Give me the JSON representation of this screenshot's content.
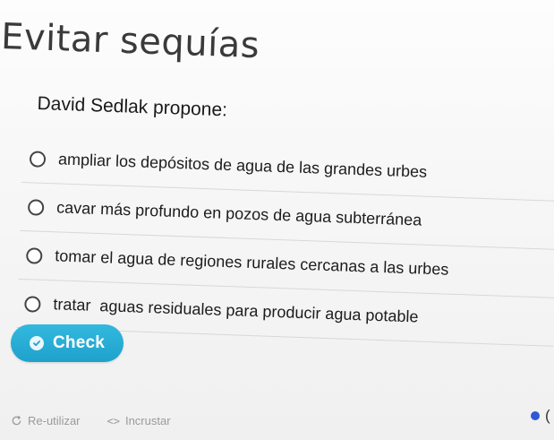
{
  "quiz": {
    "title": "Evitar sequías",
    "question": "David Sedlak propone:",
    "options": [
      {
        "label": "ampliar los depósitos de agua de las grandes urbes"
      },
      {
        "label": "cavar más profundo en pozos de agua subterránea"
      },
      {
        "label": "tomar el agua de regiones rurales cercanas a las urbes"
      },
      {
        "label": "tratar  aguas residuales para producir agua potable"
      }
    ],
    "check_label": "Check"
  },
  "footer": {
    "reuse_label": "Re-utilizar",
    "embed_label": "Incrustar",
    "embed_icon_text": "<>",
    "bracket_text": "("
  },
  "colors": {
    "button": "#1ea2cc",
    "dot": "#2f59d9"
  },
  "icons": {
    "check": "check-circle-icon",
    "reuse": "reload-icon",
    "embed": "code-icon"
  }
}
